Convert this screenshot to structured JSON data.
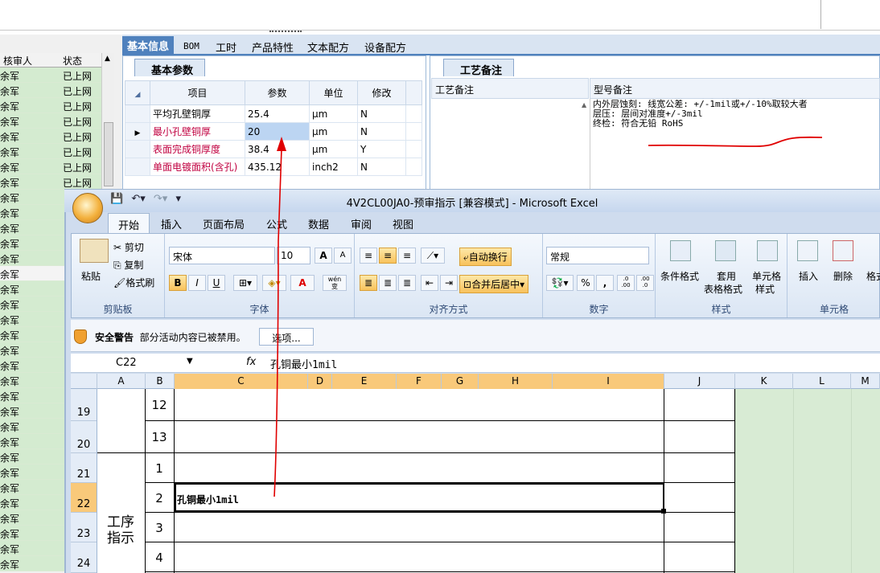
{
  "left_panel": {
    "headers": [
      "核审人",
      "状态"
    ],
    "rows": [
      [
        "余军",
        "已上网"
      ],
      [
        "余军",
        "已上网"
      ],
      [
        "余军",
        "已上网"
      ],
      [
        "余军",
        "已上网"
      ],
      [
        "余军",
        "已上网"
      ],
      [
        "余军",
        "已上网"
      ],
      [
        "余军",
        "已上网"
      ],
      [
        "余军",
        "已上网"
      ],
      [
        "余军",
        ""
      ],
      [
        "余军",
        ""
      ],
      [
        "余军",
        ""
      ],
      [
        "余军",
        ""
      ],
      [
        "余军",
        ""
      ],
      [
        "余军",
        ""
      ],
      [
        "余军",
        ""
      ],
      [
        "余军",
        ""
      ],
      [
        "余军",
        ""
      ],
      [
        "余军",
        ""
      ],
      [
        "余军",
        ""
      ],
      [
        "余军",
        ""
      ],
      [
        "余军",
        ""
      ],
      [
        "余军",
        ""
      ],
      [
        "余军",
        ""
      ],
      [
        "余军",
        ""
      ],
      [
        "余军",
        ""
      ],
      [
        "余军",
        ""
      ],
      [
        "余军",
        ""
      ],
      [
        "余军",
        ""
      ],
      [
        "余军",
        ""
      ],
      [
        "余军",
        ""
      ],
      [
        "余军",
        ""
      ],
      [
        "余军",
        ""
      ],
      [
        "余军",
        ""
      ]
    ]
  },
  "app_tabs": [
    "基本信息",
    "BOM",
    "工时",
    "产品特性",
    "文本配方",
    "设备配方"
  ],
  "basic_params": {
    "tab_title": "基本参数",
    "columns": [
      "项目",
      "参数",
      "单位",
      "修改"
    ],
    "rows": [
      {
        "item": "平均孔壁铜厚",
        "value": "25.4",
        "unit": "μm",
        "mod": "N"
      },
      {
        "item": "最小孔壁铜厚",
        "value": "20",
        "unit": "μm",
        "mod": "N"
      },
      {
        "item": "表面完成铜厚度",
        "value": "38.4",
        "unit": "μm",
        "mod": "Y"
      },
      {
        "item": "单面电镀面积(含孔)",
        "value": "435.12",
        "unit": "inch2",
        "mod": "N"
      }
    ]
  },
  "tech_notes": {
    "tab_title": "工艺备注",
    "col1": "工艺备注",
    "col2": "型号备注",
    "text": "内外层蚀刻: 线宽公差: +/-1mil或+/-10%取较大者\n层压: 层间对准度+/-3mil\n终检: 符合无铅 RoHS"
  },
  "excel": {
    "title": "4V2CL00JA0-预审指示 [兼容模式] - Microsoft Excel",
    "ribbon_tabs": [
      "开始",
      "插入",
      "页面布局",
      "公式",
      "数据",
      "审阅",
      "视图"
    ],
    "clipboard": {
      "paste": "粘贴",
      "cut": "剪切",
      "copy": "复制",
      "format_painter": "格式刷",
      "label": "剪贴板"
    },
    "font": {
      "name": "宋体",
      "size": "10",
      "label": "字体",
      "bold": "B",
      "italic": "I",
      "underline": "U",
      "grow": "A",
      "shrink": "A",
      "color": "A",
      "wen": "wén\n变"
    },
    "align": {
      "wrap": "自动换行",
      "merge": "合并后居中",
      "label": "对齐方式"
    },
    "number": {
      "format": "常规",
      "percent": "%",
      "comma": ",",
      "inc": ".0\n.00",
      "dec": ".00\n.0",
      "label": "数字"
    },
    "styles": {
      "cond": "条件格式",
      "table1": "套用",
      "table2": "表格格式",
      "cell1": "单元格",
      "cell2": "样式",
      "label": "样式"
    },
    "cells": {
      "insert": "插入",
      "delete": "删除",
      "format": "格式",
      "label": "单元格"
    },
    "security": {
      "title": "安全警告",
      "message": "部分活动内容已被禁用。",
      "options": "选项..."
    },
    "namebox": "C22",
    "fx": "fx",
    "formula": "孔铜最小1mil",
    "columns": [
      "A",
      "B",
      "C",
      "D",
      "E",
      "F",
      "G",
      "H",
      "I",
      "J",
      "K",
      "L",
      "M"
    ],
    "rows": [
      "19",
      "20",
      "21",
      "22",
      "23",
      "24"
    ],
    "b_values": [
      "12",
      "13",
      "1",
      "2",
      "3",
      "4"
    ],
    "merged_label": "工序\n指示",
    "cell_text": "孔铜最小1mil"
  },
  "annotation_color": "#e00000"
}
